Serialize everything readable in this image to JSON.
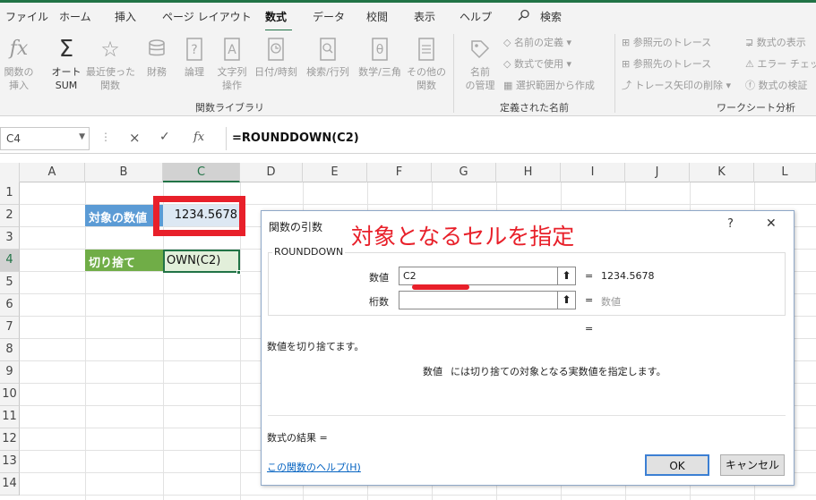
{
  "menu": {
    "items": [
      "ファイル",
      "ホーム",
      "挿入",
      "ページ レイアウト",
      "数式",
      "データ",
      "校閲",
      "表示",
      "ヘルプ"
    ],
    "search_label": "検索",
    "active": "数式"
  },
  "ribbon": {
    "insert_function": "関数の\n挿入",
    "autosum": "オート\nSUM",
    "recent": "最近使った\n関数",
    "financial": "財務",
    "logical": "論理",
    "text": "文字列\n操作",
    "datetime": "日付/時刻",
    "lookup": "検索/行列",
    "math": "数学/三角",
    "other": "その他の\n関数",
    "group_library": "関数ライブラリ",
    "name_manager": "名前\nの管理",
    "define_name": "名前の定義",
    "use_in_formula": "数式で使用",
    "create_from_selection": "選択範囲から作成",
    "group_defined_names": "定義された名前",
    "trace_precedents": "参照元のトレース",
    "trace_dependents": "参照先のトレース",
    "remove_arrows": "トレース矢印の削除",
    "show_formulas": "数式の表示",
    "error_checking": "エラー チェック",
    "evaluate_formula": "数式の検証",
    "group_auditing": "ワークシート分析"
  },
  "formula_bar": {
    "name_box": "C4",
    "cancel": "×",
    "enter": "✓",
    "fx": "fx",
    "formula": "=ROUNDDOWN(C2)"
  },
  "sheet": {
    "columns": [
      "A",
      "B",
      "C",
      "D",
      "E",
      "F",
      "G",
      "H",
      "I",
      "J",
      "K",
      "L"
    ],
    "rows": [
      "1",
      "2",
      "3",
      "4",
      "5",
      "6",
      "7",
      "8",
      "9",
      "10",
      "11",
      "12",
      "13",
      "14"
    ],
    "label_b2": "対象の数値",
    "value_c2": "1234.5678",
    "label_b4": "切り捨て",
    "value_c4": "OWN(C2)"
  },
  "annotation": {
    "text": "対象となるセルを指定",
    "color": "#e8202a"
  },
  "dialog": {
    "title": "関数の引数",
    "help_glyph": "?",
    "close_glyph": "✕",
    "function_name": "ROUNDDOWN",
    "arg1_label": "数値",
    "arg1_value": "C2",
    "arg1_result": "1234.5678",
    "arg2_label": "桁数",
    "arg2_value": "",
    "arg2_result": "数値",
    "equals": "=",
    "description": "数値を切り捨てます。",
    "arg_help_name": "数値",
    "arg_help_text": "には切り捨ての対象となる実数値を指定します。",
    "result_label": "数式の結果 =",
    "help_link": "この関数のヘルプ(H)",
    "ok_label": "OK",
    "cancel_label": "キャンセル"
  },
  "colors": {
    "excel_green": "#217346",
    "label_blue": "#5b9bd5",
    "label_green": "#70ad47",
    "highlight_red": "#e8202a"
  }
}
